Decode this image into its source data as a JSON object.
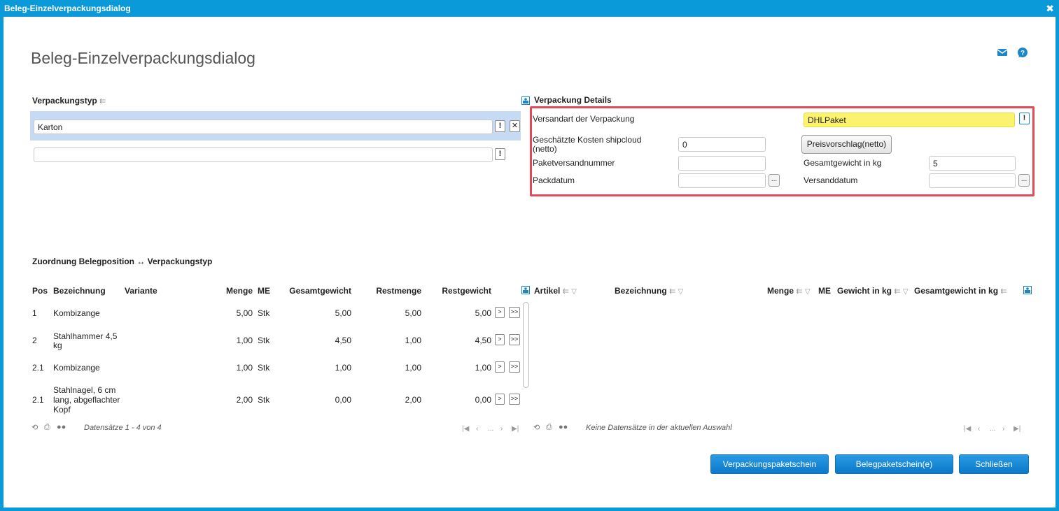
{
  "window": {
    "title": "Beleg-Einzelverpackungsdialog"
  },
  "page": {
    "title": "Beleg-Einzelverpackungsdialog"
  },
  "verpackungstyp": {
    "title": "Verpackungstyp",
    "rows": [
      {
        "value": "Karton"
      },
      {
        "value": ""
      }
    ]
  },
  "details": {
    "title": "Verpackung Details",
    "versandart_label": "Versandart der Verpackung",
    "versandart_value": "DHLPaket",
    "kosten_label_1": "Geschätzte Kosten shipcloud",
    "kosten_label_2": "(netto)",
    "kosten_value": "0",
    "preisvorschlag_button": "Preisvorschlag(netto)",
    "paketnummer_label": "Paketversandnummer",
    "paketnummer_value": "",
    "gesamtgewicht_label": "Gesamtgewicht in kg",
    "gesamtgewicht_value": "5",
    "packdatum_label": "Packdatum",
    "packdatum_value": "",
    "versanddatum_label": "Versanddatum",
    "versanddatum_value": "",
    "dots": "..."
  },
  "zuordnung": {
    "title": "Zuordnung Belegposition ↔ Verpackungstyp",
    "left": {
      "columns": {
        "pos": "Pos",
        "bezeichnung": "Bezeichnung",
        "variante": "Variante",
        "menge": "Menge",
        "me": "ME",
        "gesamtgewicht": "Gesamtgewicht",
        "restmenge": "Restmenge",
        "restgewicht": "Restgewicht"
      },
      "rows": [
        {
          "pos": "1",
          "bez": [
            "Kombizange"
          ],
          "variante": "",
          "menge": "5,00",
          "me": "Stk",
          "gesamtgewicht": "5,00",
          "restmenge": "5,00",
          "restgewicht": "5,00"
        },
        {
          "pos": "2",
          "bez": [
            "Stahlhammer 4,5",
            "kg"
          ],
          "variante": "",
          "menge": "1,00",
          "me": "Stk",
          "gesamtgewicht": "4,50",
          "restmenge": "1,00",
          "restgewicht": "4,50"
        },
        {
          "pos": "2.1",
          "bez": [
            "Kombizange"
          ],
          "variante": "",
          "menge": "1,00",
          "me": "Stk",
          "gesamtgewicht": "1,00",
          "restmenge": "1,00",
          "restgewicht": "1,00"
        },
        {
          "pos": "2.1",
          "bez": [
            "Stahlnagel, 6 cm",
            "lang, abgeflachter",
            "Kopf"
          ],
          "variante": "",
          "menge": "2,00",
          "me": "Stk",
          "gesamtgewicht": "0,00",
          "restmenge": "2,00",
          "restgewicht": "0,00"
        }
      ],
      "move_one": ">",
      "move_all": ">>",
      "footer": "Datensätze 1 - 4 von 4"
    },
    "right": {
      "columns": {
        "artikel": "Artikel",
        "bezeichnung": "Bezeichnung",
        "menge": "Menge",
        "me": "ME",
        "gewicht": "Gewicht in kg",
        "gesamtgewicht": "Gesamtgewicht in kg"
      },
      "footer": "Keine Datensätze in der aktuellen Auswahl"
    },
    "pager_dots": "..."
  },
  "buttons": {
    "verpackungspaketschein": "Verpackungspaketschein",
    "belegpaketschein": "Belegpaketschein(e)",
    "schliessen": "Schließen"
  },
  "colors": {
    "accent": "#0a9ad9",
    "highlight": "#e04b57",
    "yellow": "#fbf26e",
    "selection": "#c6daf3"
  }
}
